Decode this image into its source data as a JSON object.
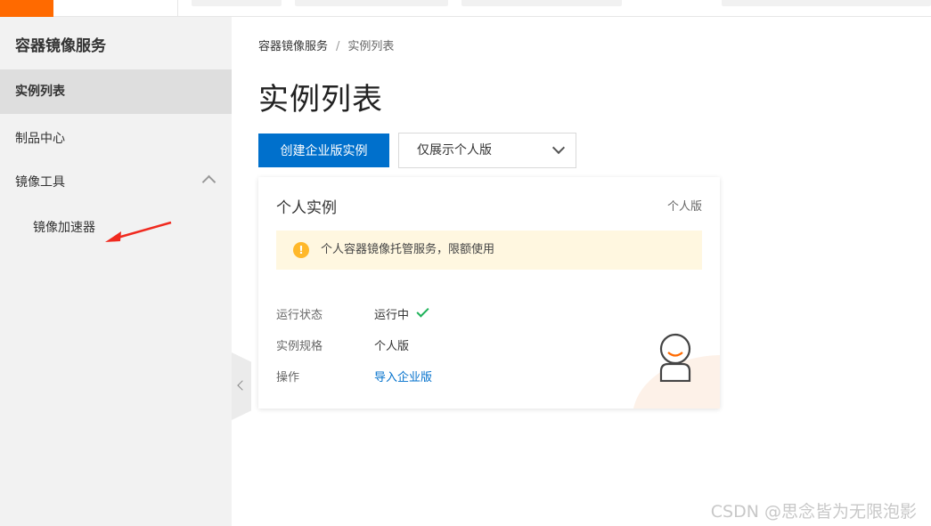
{
  "sidebar": {
    "title": "容器镜像服务",
    "items": [
      {
        "label": "实例列表"
      },
      {
        "label": "制品中心"
      },
      {
        "label": "镜像工具"
      },
      {
        "label": "镜像加速器"
      }
    ]
  },
  "breadcrumb": {
    "root": "容器镜像服务",
    "sep": "/",
    "current": "实例列表"
  },
  "page_title": "实例列表",
  "toolbar": {
    "create_label": "创建企业版实例",
    "filter_value": "仅展示个人版"
  },
  "card": {
    "title": "个人实例",
    "badge": "个人版",
    "notice": "个人容器镜像托管服务，限额使用",
    "rows": [
      {
        "label": "运行状态",
        "value": "运行中"
      },
      {
        "label": "实例规格",
        "value": "个人版"
      },
      {
        "label": "操作",
        "value": "导入企业版"
      }
    ]
  },
  "watermark": "CSDN @思念皆为无限泡影",
  "colors": {
    "accent": "#0070cc",
    "brand_orange": "#ff6a00",
    "success": "#1fb25a",
    "warn": "#ffb82a"
  }
}
